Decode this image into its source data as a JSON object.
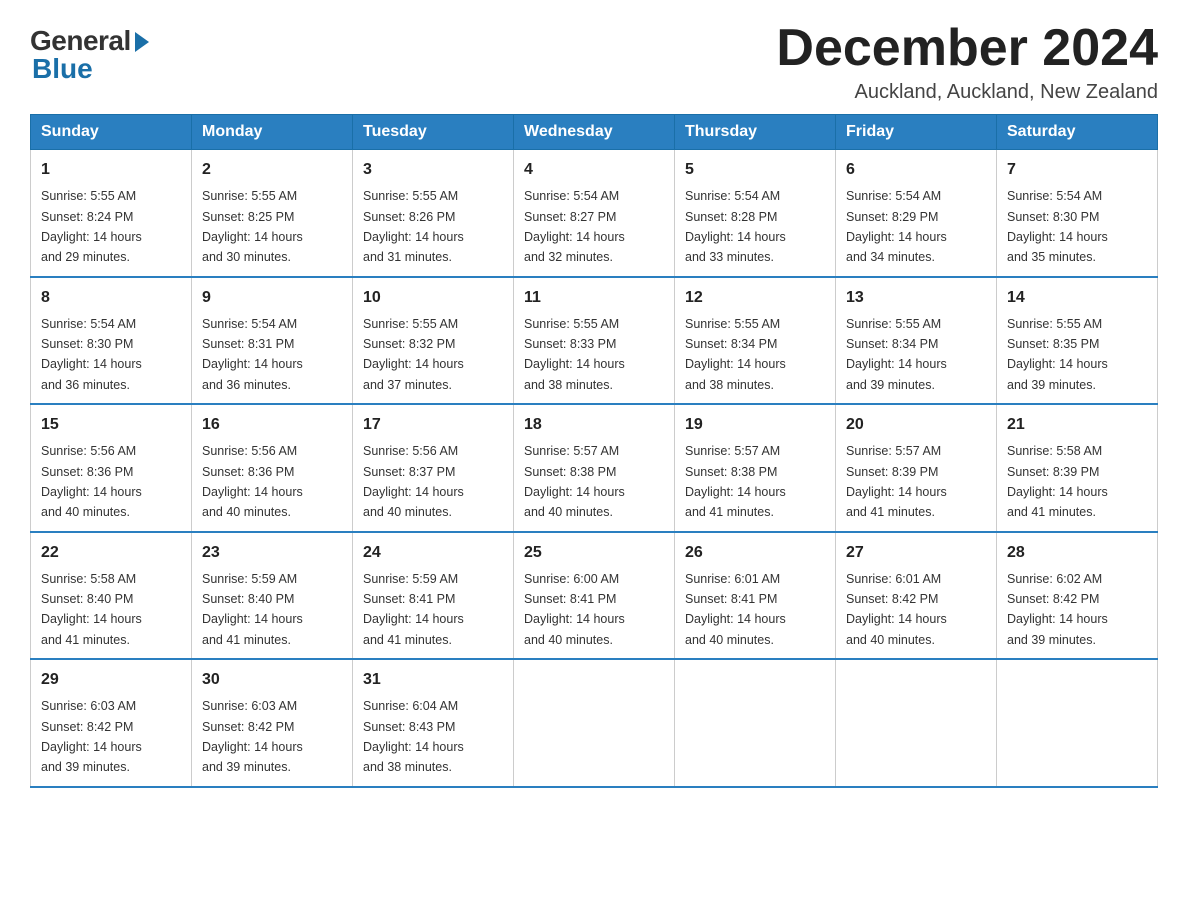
{
  "logo": {
    "general": "General",
    "blue": "Blue"
  },
  "title": "December 2024",
  "subtitle": "Auckland, Auckland, New Zealand",
  "days_of_week": [
    "Sunday",
    "Monday",
    "Tuesday",
    "Wednesday",
    "Thursday",
    "Friday",
    "Saturday"
  ],
  "weeks": [
    [
      {
        "day": "1",
        "sunrise": "5:55 AM",
        "sunset": "8:24 PM",
        "daylight": "14 hours and 29 minutes."
      },
      {
        "day": "2",
        "sunrise": "5:55 AM",
        "sunset": "8:25 PM",
        "daylight": "14 hours and 30 minutes."
      },
      {
        "day": "3",
        "sunrise": "5:55 AM",
        "sunset": "8:26 PM",
        "daylight": "14 hours and 31 minutes."
      },
      {
        "day": "4",
        "sunrise": "5:54 AM",
        "sunset": "8:27 PM",
        "daylight": "14 hours and 32 minutes."
      },
      {
        "day": "5",
        "sunrise": "5:54 AM",
        "sunset": "8:28 PM",
        "daylight": "14 hours and 33 minutes."
      },
      {
        "day": "6",
        "sunrise": "5:54 AM",
        "sunset": "8:29 PM",
        "daylight": "14 hours and 34 minutes."
      },
      {
        "day": "7",
        "sunrise": "5:54 AM",
        "sunset": "8:30 PM",
        "daylight": "14 hours and 35 minutes."
      }
    ],
    [
      {
        "day": "8",
        "sunrise": "5:54 AM",
        "sunset": "8:30 PM",
        "daylight": "14 hours and 36 minutes."
      },
      {
        "day": "9",
        "sunrise": "5:54 AM",
        "sunset": "8:31 PM",
        "daylight": "14 hours and 36 minutes."
      },
      {
        "day": "10",
        "sunrise": "5:55 AM",
        "sunset": "8:32 PM",
        "daylight": "14 hours and 37 minutes."
      },
      {
        "day": "11",
        "sunrise": "5:55 AM",
        "sunset": "8:33 PM",
        "daylight": "14 hours and 38 minutes."
      },
      {
        "day": "12",
        "sunrise": "5:55 AM",
        "sunset": "8:34 PM",
        "daylight": "14 hours and 38 minutes."
      },
      {
        "day": "13",
        "sunrise": "5:55 AM",
        "sunset": "8:34 PM",
        "daylight": "14 hours and 39 minutes."
      },
      {
        "day": "14",
        "sunrise": "5:55 AM",
        "sunset": "8:35 PM",
        "daylight": "14 hours and 39 minutes."
      }
    ],
    [
      {
        "day": "15",
        "sunrise": "5:56 AM",
        "sunset": "8:36 PM",
        "daylight": "14 hours and 40 minutes."
      },
      {
        "day": "16",
        "sunrise": "5:56 AM",
        "sunset": "8:36 PM",
        "daylight": "14 hours and 40 minutes."
      },
      {
        "day": "17",
        "sunrise": "5:56 AM",
        "sunset": "8:37 PM",
        "daylight": "14 hours and 40 minutes."
      },
      {
        "day": "18",
        "sunrise": "5:57 AM",
        "sunset": "8:38 PM",
        "daylight": "14 hours and 40 minutes."
      },
      {
        "day": "19",
        "sunrise": "5:57 AM",
        "sunset": "8:38 PM",
        "daylight": "14 hours and 41 minutes."
      },
      {
        "day": "20",
        "sunrise": "5:57 AM",
        "sunset": "8:39 PM",
        "daylight": "14 hours and 41 minutes."
      },
      {
        "day": "21",
        "sunrise": "5:58 AM",
        "sunset": "8:39 PM",
        "daylight": "14 hours and 41 minutes."
      }
    ],
    [
      {
        "day": "22",
        "sunrise": "5:58 AM",
        "sunset": "8:40 PM",
        "daylight": "14 hours and 41 minutes."
      },
      {
        "day": "23",
        "sunrise": "5:59 AM",
        "sunset": "8:40 PM",
        "daylight": "14 hours and 41 minutes."
      },
      {
        "day": "24",
        "sunrise": "5:59 AM",
        "sunset": "8:41 PM",
        "daylight": "14 hours and 41 minutes."
      },
      {
        "day": "25",
        "sunrise": "6:00 AM",
        "sunset": "8:41 PM",
        "daylight": "14 hours and 40 minutes."
      },
      {
        "day": "26",
        "sunrise": "6:01 AM",
        "sunset": "8:41 PM",
        "daylight": "14 hours and 40 minutes."
      },
      {
        "day": "27",
        "sunrise": "6:01 AM",
        "sunset": "8:42 PM",
        "daylight": "14 hours and 40 minutes."
      },
      {
        "day": "28",
        "sunrise": "6:02 AM",
        "sunset": "8:42 PM",
        "daylight": "14 hours and 39 minutes."
      }
    ],
    [
      {
        "day": "29",
        "sunrise": "6:03 AM",
        "sunset": "8:42 PM",
        "daylight": "14 hours and 39 minutes."
      },
      {
        "day": "30",
        "sunrise": "6:03 AM",
        "sunset": "8:42 PM",
        "daylight": "14 hours and 39 minutes."
      },
      {
        "day": "31",
        "sunrise": "6:04 AM",
        "sunset": "8:43 PM",
        "daylight": "14 hours and 38 minutes."
      },
      null,
      null,
      null,
      null
    ]
  ],
  "labels": {
    "sunrise": "Sunrise:",
    "sunset": "Sunset:",
    "daylight": "Daylight: 14 hours"
  }
}
